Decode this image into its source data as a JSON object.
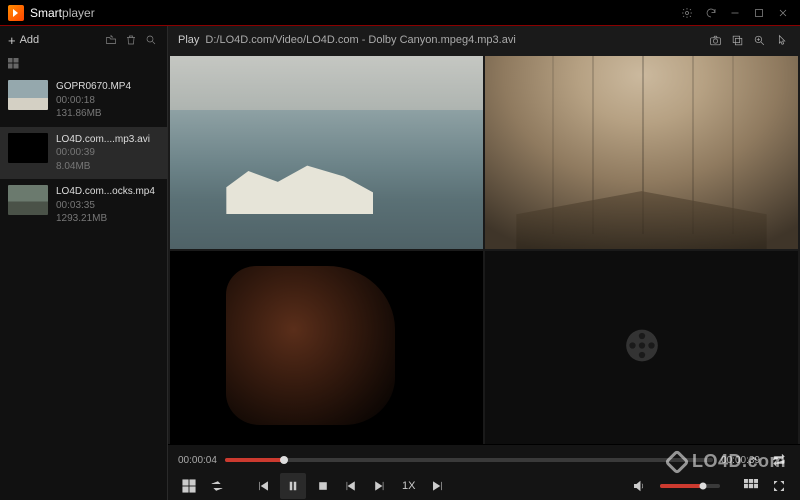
{
  "app": {
    "name_bold": "Smart",
    "name_thin": "player"
  },
  "sidebar": {
    "add_label": "Add",
    "items": [
      {
        "name": "GOPR0670.MP4",
        "duration": "00:00:18",
        "size": "131.86MB"
      },
      {
        "name": "LO4D.com....mp3.avi",
        "duration": "00:00:39",
        "size": "8.04MB"
      },
      {
        "name": "LO4D.com...ocks.mp4",
        "duration": "00:03:35",
        "size": "1293.21MB"
      }
    ]
  },
  "infobar": {
    "play_label": "Play",
    "path": "D:/LO4D.com/Video/LO4D.com - Dolby Canyon.mpeg4.mp3.avi"
  },
  "transport": {
    "current": "00:00:04",
    "total": "00:00:39",
    "progress_pct": 12,
    "speed": "1X",
    "volume_pct": 72
  },
  "watermark": "LO4D.com",
  "colors": {
    "accent": "#cc3a2f"
  },
  "icons": {
    "settings": "settings-icon",
    "refresh": "refresh-icon",
    "minimize": "minimize-icon",
    "maximize": "maximize-icon",
    "close": "close-icon",
    "folder": "folder-icon",
    "trash": "trash-icon",
    "search": "search-icon",
    "camera": "camera-icon",
    "copy": "copy-icon",
    "zoom": "zoom-icon",
    "pointer": "pointer-icon"
  }
}
